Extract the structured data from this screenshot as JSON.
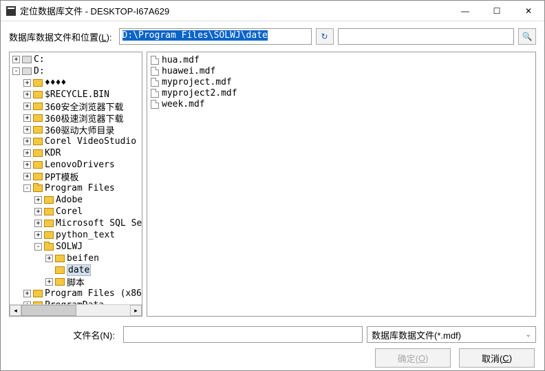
{
  "window": {
    "title": "定位数据库文件 - DESKTOP-I67A629"
  },
  "toolbar": {
    "label_pre": "数据库数据文件和位置(",
    "label_key": "L",
    "label_post": "):",
    "path": "D:\\Program Files\\SOLWJ\\date",
    "search_placeholder": ""
  },
  "tree": [
    {
      "indent": 0,
      "exp": "+",
      "icon": "drive",
      "label": "C:"
    },
    {
      "indent": 0,
      "exp": "-",
      "icon": "drive",
      "label": "D:"
    },
    {
      "indent": 1,
      "exp": "+",
      "icon": "folder",
      "label": "♦♦♦♦"
    },
    {
      "indent": 1,
      "exp": "+",
      "icon": "folder",
      "label": "$RECYCLE.BIN"
    },
    {
      "indent": 1,
      "exp": "+",
      "icon": "folder",
      "label": "360安全浏览器下载"
    },
    {
      "indent": 1,
      "exp": "+",
      "icon": "folder",
      "label": "360极速浏览器下载"
    },
    {
      "indent": 1,
      "exp": "+",
      "icon": "folder",
      "label": "360驱动大师目录"
    },
    {
      "indent": 1,
      "exp": "+",
      "icon": "folder",
      "label": "Corel VideoStudio"
    },
    {
      "indent": 1,
      "exp": "+",
      "icon": "folder",
      "label": "KDR"
    },
    {
      "indent": 1,
      "exp": "+",
      "icon": "folder",
      "label": "LenovoDrivers"
    },
    {
      "indent": 1,
      "exp": "+",
      "icon": "folder",
      "label": "PPT模板"
    },
    {
      "indent": 1,
      "exp": "-",
      "icon": "folder-open",
      "label": "Program Files"
    },
    {
      "indent": 2,
      "exp": "+",
      "icon": "folder",
      "label": "Adobe"
    },
    {
      "indent": 2,
      "exp": "+",
      "icon": "folder",
      "label": "Corel"
    },
    {
      "indent": 2,
      "exp": "+",
      "icon": "folder",
      "label": "Microsoft SQL Se"
    },
    {
      "indent": 2,
      "exp": "+",
      "icon": "folder",
      "label": "python_text"
    },
    {
      "indent": 2,
      "exp": "-",
      "icon": "folder-open",
      "label": "SOLWJ"
    },
    {
      "indent": 3,
      "exp": "+",
      "icon": "folder",
      "label": "beifen"
    },
    {
      "indent": 3,
      "exp": " ",
      "icon": "folder",
      "label": "date",
      "selected": true
    },
    {
      "indent": 3,
      "exp": "+",
      "icon": "folder",
      "label": "脚本"
    },
    {
      "indent": 1,
      "exp": "+",
      "icon": "folder",
      "label": "Program Files (x86"
    },
    {
      "indent": 1,
      "exp": "+",
      "icon": "folder",
      "label": "ProgramData"
    }
  ],
  "files": [
    "hua.mdf",
    "huawei.mdf",
    "myproject.mdf",
    "myproject2.mdf",
    "week.mdf"
  ],
  "footer": {
    "filename_label_pre": "文件名(",
    "filename_label_key": "N",
    "filename_label_post": "):",
    "filename_value": "",
    "filetype": "数据库数据文件(*.mdf)",
    "ok_pre": "确定(",
    "ok_key": "O",
    "ok_post": ")",
    "cancel_pre": "取消(",
    "cancel_key": "C",
    "cancel_post": ")"
  }
}
